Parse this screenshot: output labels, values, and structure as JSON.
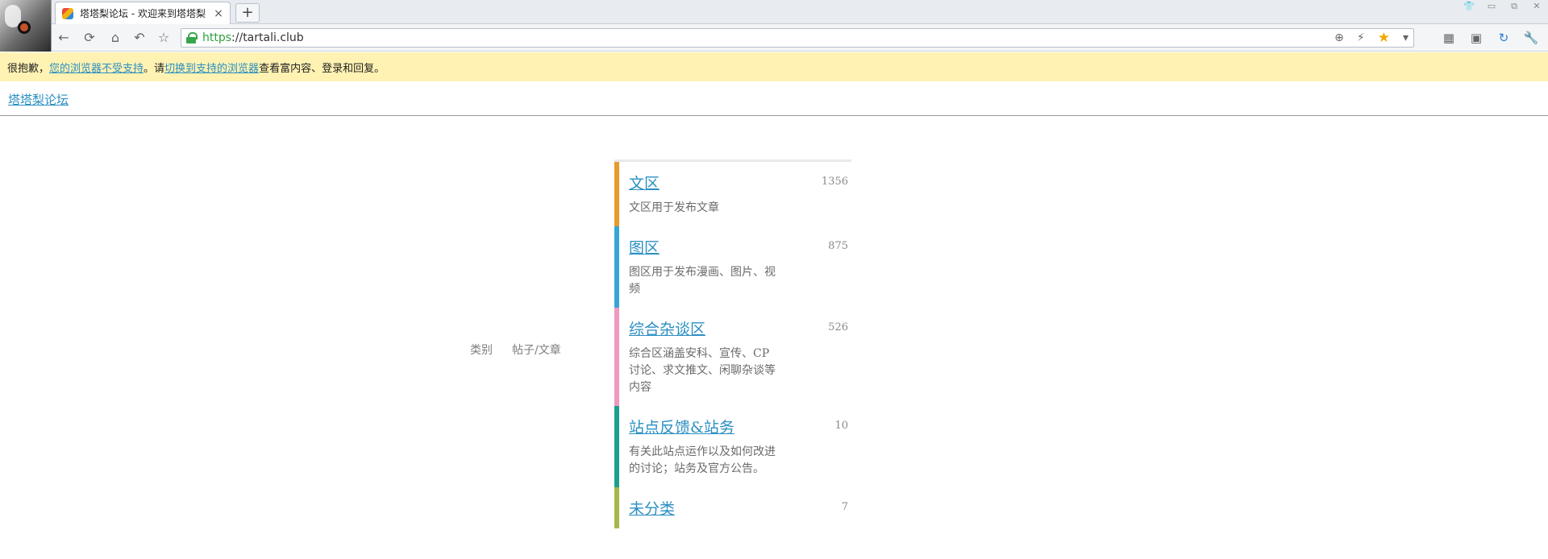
{
  "browser": {
    "tab": {
      "title": "塔塔梨论坛 - 欢迎来到塔塔梨",
      "close": "×"
    },
    "new_tab": "+",
    "window_controls": [
      "👕",
      "▭",
      "⧉",
      "✕"
    ],
    "nav": {
      "back": "←",
      "refresh": "⟳",
      "home": "⌂",
      "undo": "↶",
      "favorite": "☆"
    },
    "address": {
      "scheme": "https",
      "rest": "://tartali.club"
    },
    "address_actions": {
      "add": "⊕",
      "lightning": "⚡",
      "star": "★",
      "dropdown": "▾"
    },
    "toolbar_icons": [
      "▦",
      "▣",
      "↻",
      "🔧"
    ],
    "accent_colors": {
      "lock": "#37a64a",
      "star": "#f0a800",
      "link": "#2b8fc2"
    }
  },
  "notice": {
    "prefix": "很抱歉，",
    "link1": "您的浏览器不受支持",
    "middle": "。请",
    "link2": "切换到支持的浏览器",
    "suffix": "查看富内容、登录和回复。",
    "background": "#fff2b3"
  },
  "site": {
    "title": "塔塔梨论坛"
  },
  "table_headers": {
    "category": "类别",
    "posts": "帖子/文章"
  },
  "categories": [
    {
      "name": "文区",
      "count": "1356",
      "desc": "文区用于发布文章",
      "color": "#e89a2c"
    },
    {
      "name": "图区",
      "count": "875",
      "desc": "图区用于发布漫画、图片、视频",
      "color": "#35a6d6"
    },
    {
      "name": "综合杂谈区",
      "count": "526",
      "desc": "综合区涵盖安科、宣传、CP讨论、求文推文、闲聊杂谈等内容",
      "color": "#ee99c0"
    },
    {
      "name": "站点反馈&站务",
      "count": "10",
      "desc": "有关此站点运作以及如何改进的讨论；站务及官方公告。",
      "color": "#1aa08c"
    },
    {
      "name": "未分类",
      "count": "7",
      "desc": "",
      "color": "#a5b84a"
    }
  ]
}
